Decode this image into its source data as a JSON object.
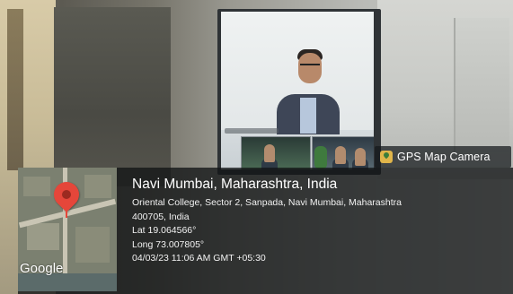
{
  "watermark": {
    "app_label": "GPS Map Camera",
    "icon": "gps-map-camera-icon"
  },
  "map": {
    "provider_label": "Google",
    "pin_icon": "map-pin-icon",
    "pin_color": "#e5463a"
  },
  "location": {
    "title": "Navi Mumbai, Maharashtra, India",
    "address_line1": "Oriental College, Sector 2, Sanpada, Navi Mumbai, Maharashtra",
    "address_line2": "400705, India",
    "latitude": "Lat 19.064566°",
    "longitude": "Long 73.007805°",
    "timestamp": "04/03/23 11:06 AM GMT +05:30"
  },
  "colors": {
    "panel_bg": "rgba(18,20,22,0.78)",
    "text": "#ffffff",
    "badge_icon": "#e0b54a"
  }
}
